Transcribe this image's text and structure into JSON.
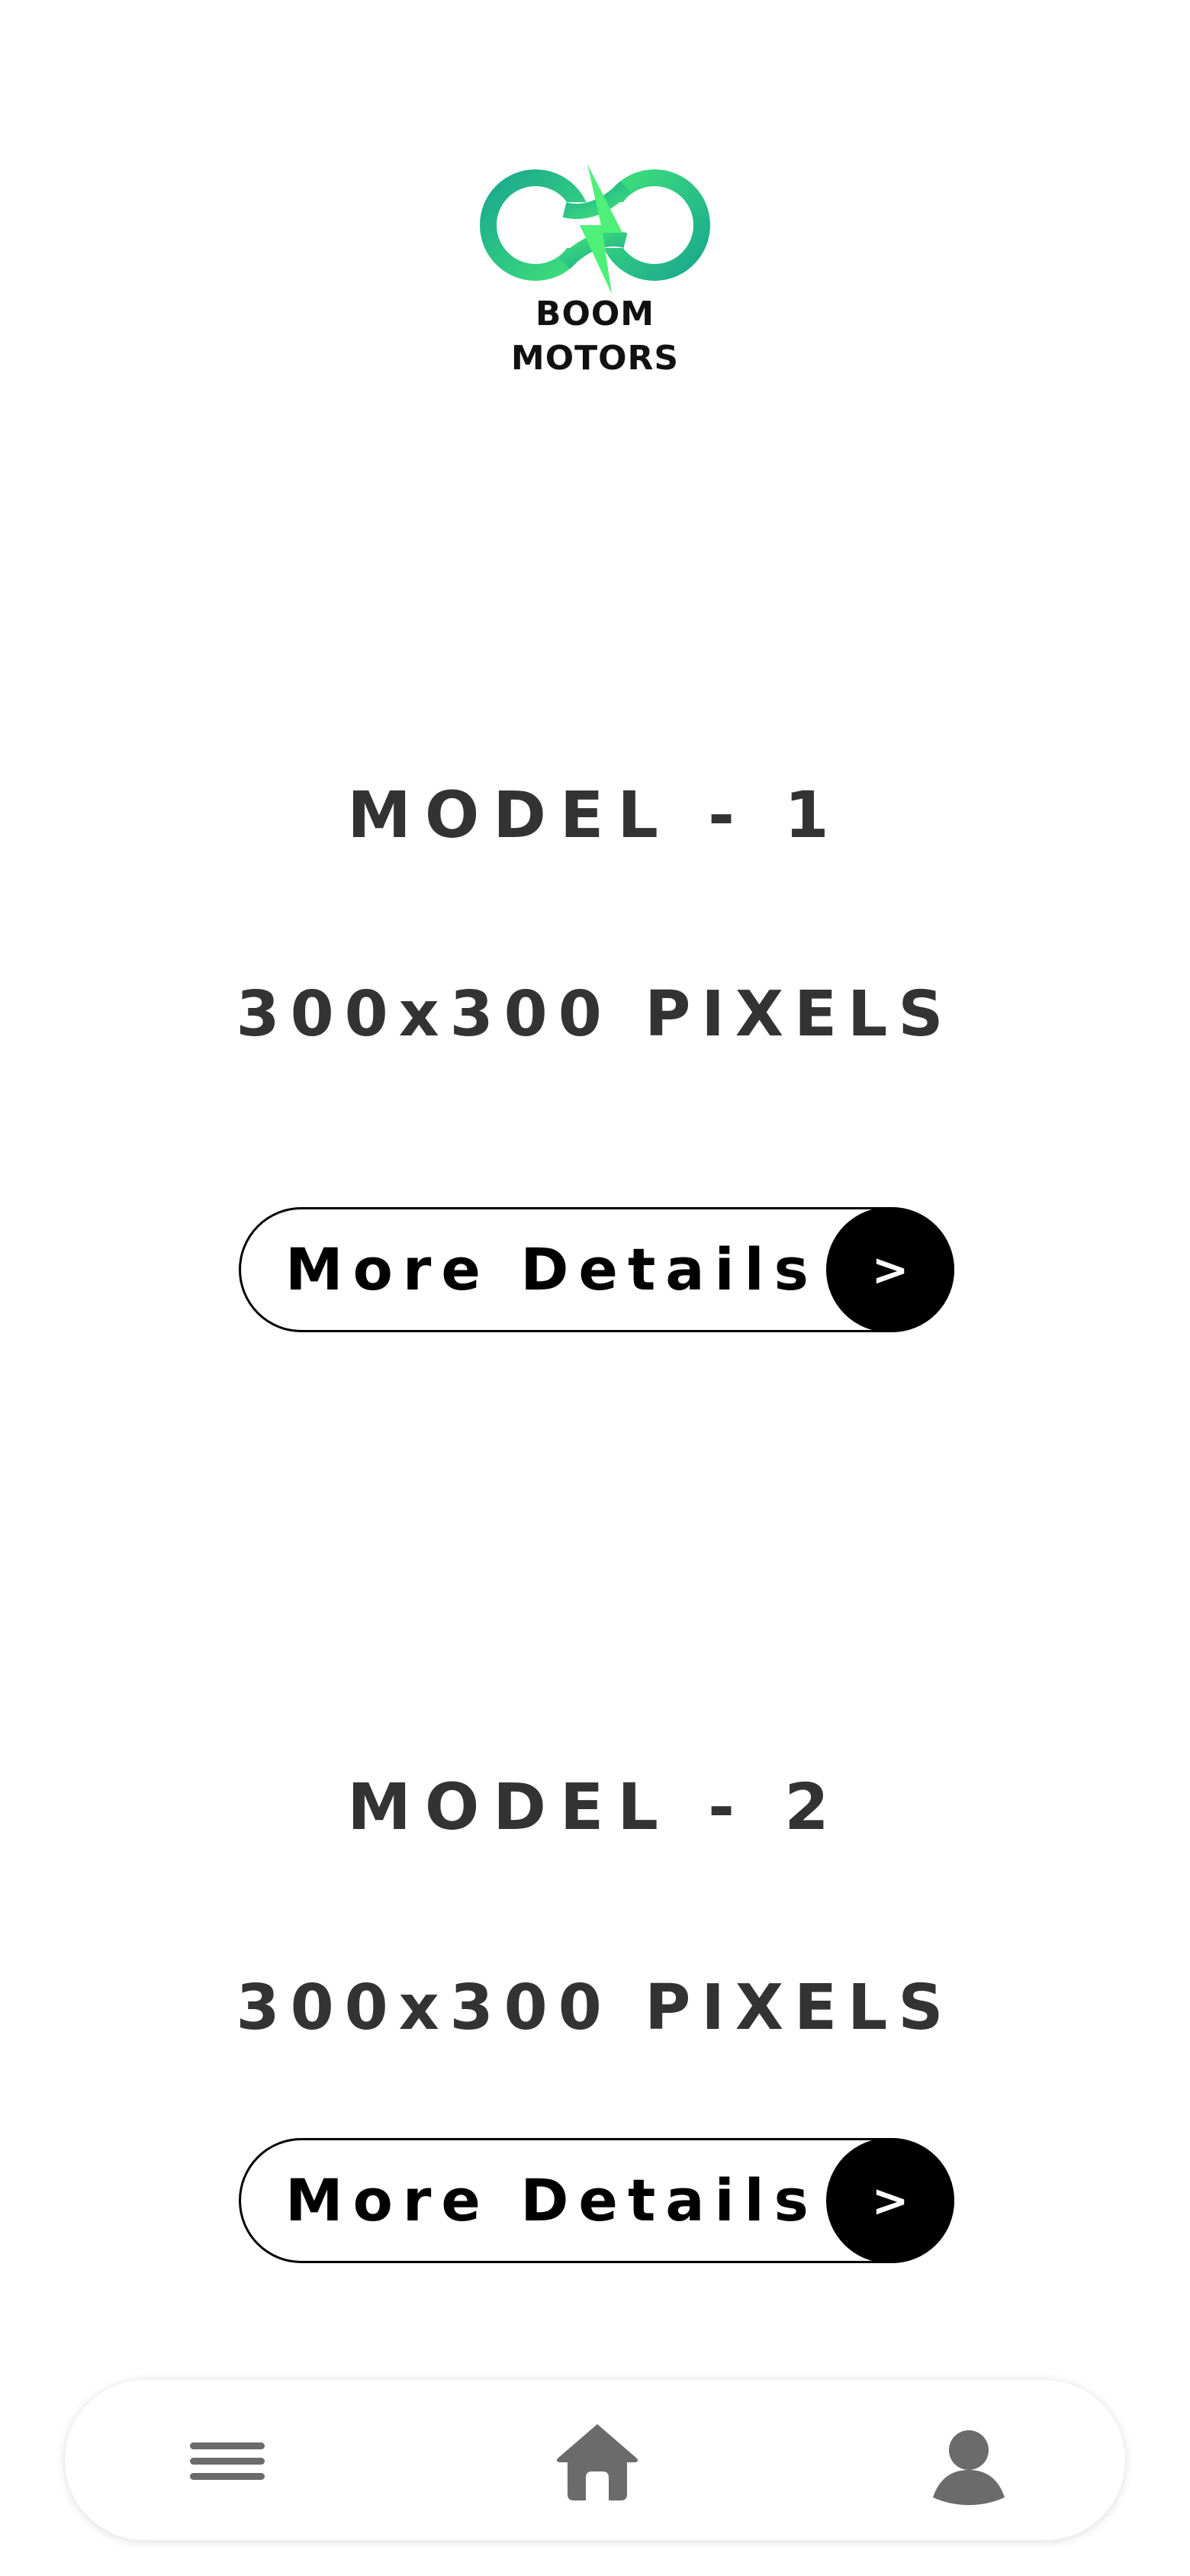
{
  "brand": {
    "line1": "BOOM",
    "line2": "MOTORS",
    "logo_icon": "infinity-bolt-logo",
    "accent_start": "#1aa88e",
    "accent_end": "#4ff07a"
  },
  "models": [
    {
      "title": "MODEL - 1",
      "subtitle": "300x300 PIXELS",
      "button_label": "More Details",
      "button_arrow": ">"
    },
    {
      "title": "MODEL - 2",
      "subtitle": "300x300 PIXELS",
      "button_label": "More Details",
      "button_arrow": ">"
    }
  ],
  "bottom_nav": {
    "items": [
      {
        "icon": "menu-icon"
      },
      {
        "icon": "home-icon"
      },
      {
        "icon": "profile-icon"
      }
    ],
    "icon_color": "#6b6b6b"
  }
}
